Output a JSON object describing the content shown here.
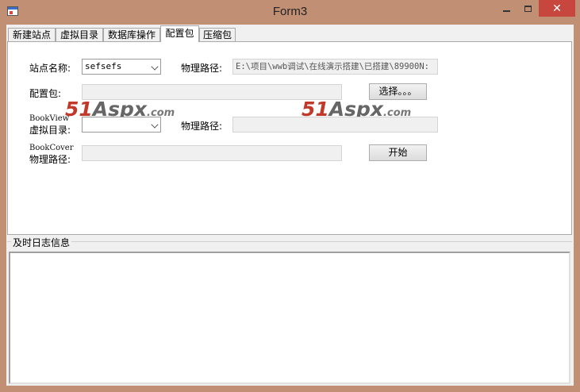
{
  "window": {
    "title": "Form3",
    "close_glyph": "✕"
  },
  "tabs": [
    {
      "label": "新建站点"
    },
    {
      "label": "虚拟目录"
    },
    {
      "label": "数据库操作"
    },
    {
      "label": "配置包"
    },
    {
      "label": "压缩包"
    }
  ],
  "active_tab_index": 3,
  "form": {
    "site_name_label": "站点名称:",
    "site_name_value": "sefsefs",
    "physical_path_label": "物理路径:",
    "physical_path_value": "E:\\项目\\wwb调试\\在线演示搭建\\已搭建\\89900N:",
    "config_pack_label": "配置包:",
    "config_pack_value": "",
    "select_button_label": "选择。。。",
    "bookview_label": "BookView",
    "virtual_dir_label": "虚拟目录:",
    "virtual_dir_value": "",
    "physical_path2_label": "物理路径:",
    "physical_path2_value": "",
    "bookcover_label": "BookCover",
    "bookcover_path_label": "物理路径:",
    "bookcover_path_value": "",
    "start_button_label": "开始"
  },
  "watermark": {
    "num": "51",
    "brand": "Aspx",
    "domain": ".com"
  },
  "log": {
    "title": "及时日志信息",
    "content": ""
  }
}
